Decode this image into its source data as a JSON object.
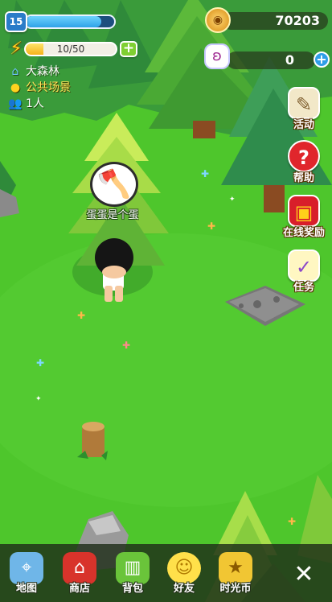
{
  "player": {
    "level": "15",
    "level_progress": 0.85,
    "energy_text": "10/50",
    "energy_progress": 0.2,
    "name": "蛋蛋是个蛋"
  },
  "location": {
    "area": "大森林",
    "scene": "公共场景",
    "population": "1人"
  },
  "currency": {
    "coins": "70203",
    "tickets": "0"
  },
  "side_menu": [
    {
      "label": "活动",
      "icon": "activity-scroll-icon"
    },
    {
      "label": "帮助",
      "icon": "help-question-icon"
    },
    {
      "label": "在线奖励",
      "icon": "treasure-chest-icon"
    },
    {
      "label": "任务",
      "icon": "task-notebook-icon"
    }
  ],
  "bottom_nav": [
    {
      "label": "地图",
      "icon": "map-icon"
    },
    {
      "label": "商店",
      "icon": "shop-icon"
    },
    {
      "label": "背包",
      "icon": "backpack-icon"
    },
    {
      "label": "好友",
      "icon": "friends-icon"
    },
    {
      "label": "时光币",
      "icon": "time-coin-icon"
    }
  ],
  "colors": {
    "grass": "#4ec62c",
    "tree_dark": "#2f8f3a",
    "tree_light": "#9ee04a",
    "trunk": "#8a4b22"
  }
}
